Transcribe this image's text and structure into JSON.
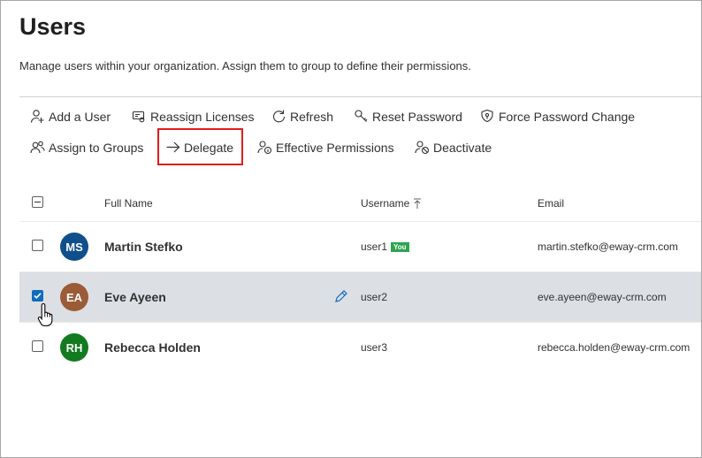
{
  "page": {
    "title": "Users",
    "description": "Manage users within your organization. Assign them to group to define their permissions."
  },
  "toolbar": {
    "add_user": "Add a User",
    "reassign_licenses": "Reassign Licenses",
    "refresh": "Refresh",
    "reset_password": "Reset Password",
    "force_password_change": "Force Password Change",
    "assign_to_groups": "Assign to Groups",
    "delegate": "Delegate",
    "effective_permissions": "Effective Permissions",
    "deactivate": "Deactivate"
  },
  "table": {
    "columns": {
      "full_name": "Full Name",
      "username": "Username",
      "email": "Email"
    },
    "rows": [
      {
        "initials": "MS",
        "avatar_color": "#0f4f8b",
        "full_name": "Martin Stefko",
        "username": "user1",
        "badge": "You",
        "email": "martin.stefko@eway-crm.com",
        "selected": false
      },
      {
        "initials": "EA",
        "avatar_color": "#9a5b36",
        "full_name": "Eve Ayeen",
        "username": "user2",
        "badge": "",
        "email": "eve.ayeen@eway-crm.com",
        "selected": true
      },
      {
        "initials": "RH",
        "avatar_color": "#137a1f",
        "full_name": "Rebecca Holden",
        "username": "user3",
        "badge": "",
        "email": "rebecca.holden@eway-crm.com",
        "selected": false
      }
    ]
  },
  "colors": {
    "accent": "#0f6cbd",
    "highlight": "#e21b1b",
    "selected_row": "#dcdfe4",
    "badge": "#2ea44f"
  }
}
